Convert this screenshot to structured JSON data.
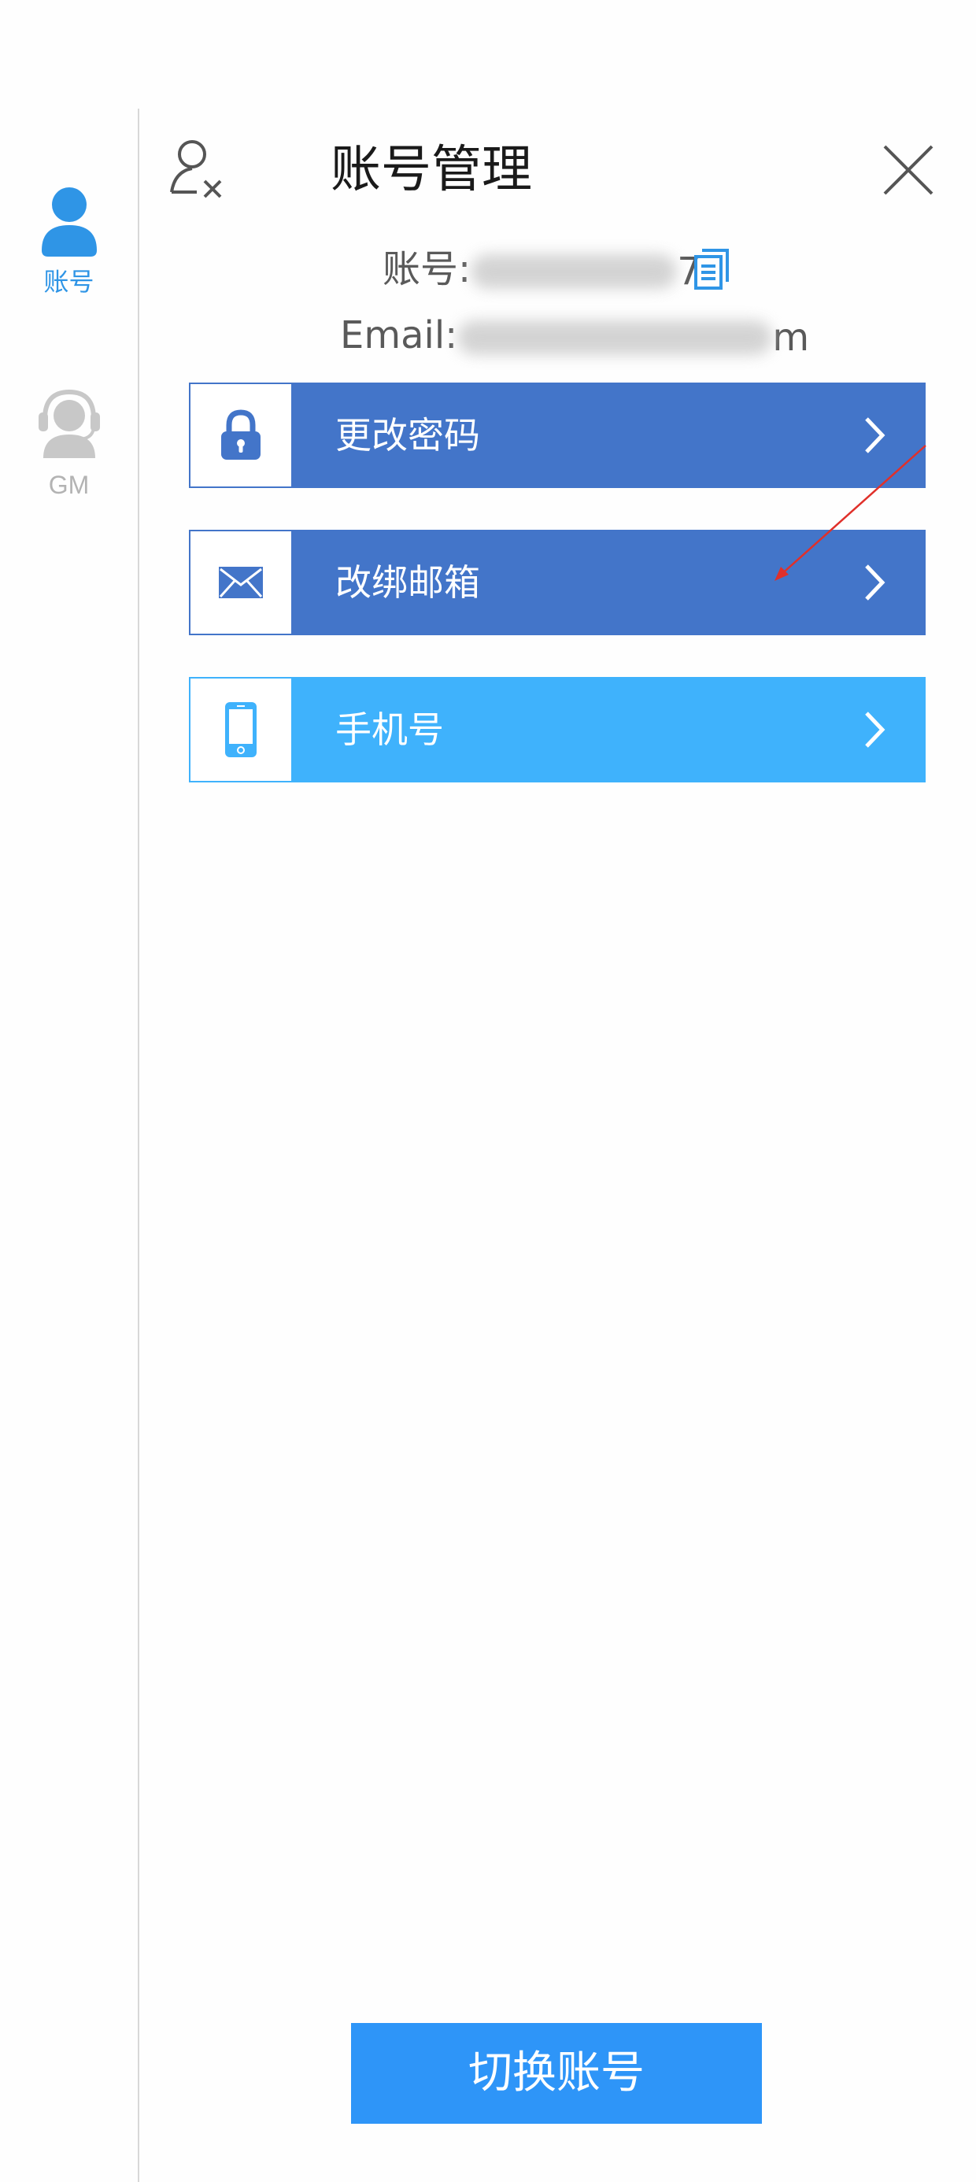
{
  "sidebar": {
    "items": [
      {
        "label": "账号",
        "icon": "user-icon",
        "active": true
      },
      {
        "label": "GM",
        "icon": "headset-support-icon",
        "active": false
      }
    ],
    "active_color": "#2f95e6",
    "inactive_color": "#b3b3b3"
  },
  "header": {
    "title": "账号管理",
    "left_icon": "user-remove-icon",
    "right_icon": "close-icon"
  },
  "account_info": {
    "account_label": "账号:",
    "account_value_visible_suffix": "7",
    "email_label": "Email:",
    "email_value_visible_suffix": "m",
    "copy_icon": "copy-icon"
  },
  "menu": [
    {
      "label": "更改密码",
      "icon": "lock-icon",
      "color": "#4375c9"
    },
    {
      "label": "改绑邮箱",
      "icon": "envelope-icon",
      "color": "#4375c9"
    },
    {
      "label": "手机号",
      "icon": "phone-icon",
      "color": "#3fb2fc"
    }
  ],
  "footer": {
    "switch_account_label": "切换账号",
    "color": "#2e95f8"
  }
}
